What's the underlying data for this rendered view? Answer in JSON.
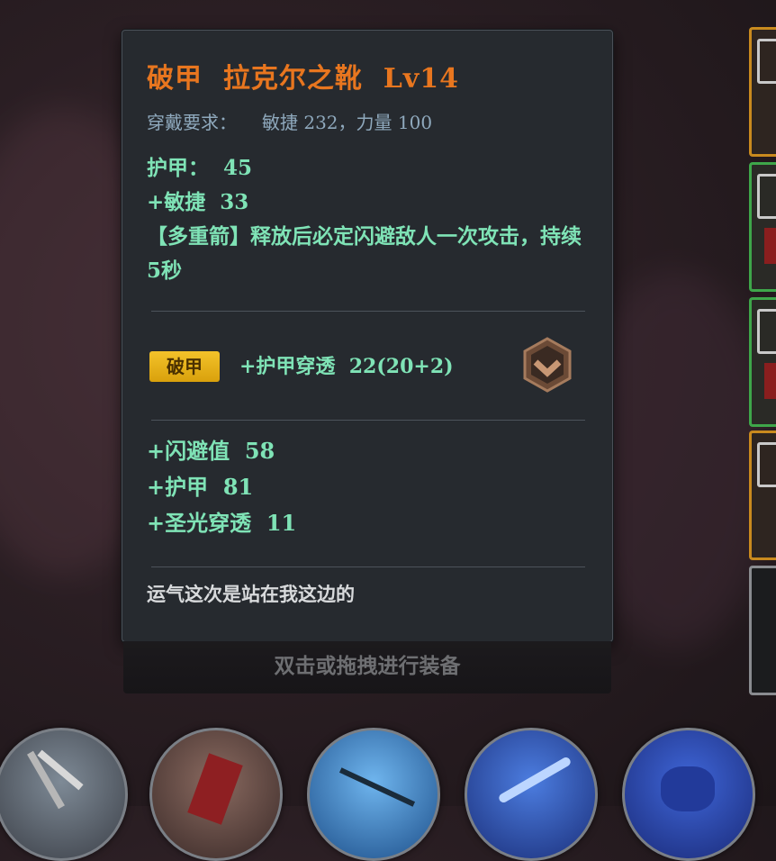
{
  "tooltip": {
    "title": "破甲  拉克尔之靴  Lv14",
    "requirement_label": "穿戴要求：",
    "requirement_value": "敏捷 232，力量 100",
    "base_stats": [
      "护甲：  45",
      "+敏捷  33",
      "【多重箭】释放后必定闪避敌人一次攻击，持续5秒"
    ],
    "affix": {
      "badge": "破甲",
      "text": "+护甲穿透  22(20+2)",
      "icon": "bronze-shield-chevron-icon"
    },
    "extra_stats": [
      "+闪避值  58",
      "+护甲  81",
      "+圣光穿透  11"
    ],
    "flavor_text": "运气这次是站在我这边的"
  },
  "hint": "双击或拖拽进行装备",
  "colors": {
    "title": "#e8761f",
    "stat_green": "#7fe3b6",
    "badge_gold": "#e6b21a",
    "panel_bg": "#262a2f"
  },
  "side_slots": [
    {
      "border": "orange",
      "icon": "item-slot-icon"
    },
    {
      "border": "green",
      "icon": "item-slot-icon"
    },
    {
      "border": "green",
      "icon": "item-slot-icon"
    },
    {
      "border": "orange",
      "icon": "item-slot-icon"
    },
    {
      "border": "gray",
      "icon": "item-slot-icon"
    }
  ],
  "skills": [
    "crossbow-skill-icon",
    "blade-skill-icon",
    "arrow-skill-icon",
    "blue-slash-skill-icon",
    "blue-beast-skill-icon"
  ]
}
